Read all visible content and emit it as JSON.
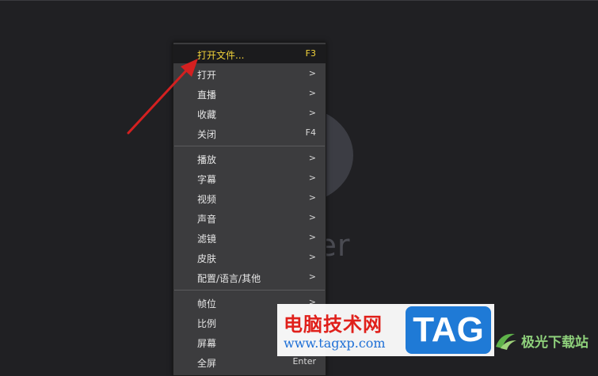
{
  "background": {
    "color": "#202023"
  },
  "player": {
    "brand_partial": "yer"
  },
  "context_menu": {
    "groups": [
      [
        {
          "label": "打开文件...",
          "shortcut": "F3",
          "highlighted": true
        },
        {
          "label": "打开",
          "shortcut": ">"
        },
        {
          "label": "直播",
          "shortcut": ">"
        },
        {
          "label": "收藏",
          "shortcut": ">"
        },
        {
          "label": "关闭",
          "shortcut": "F4"
        }
      ],
      [
        {
          "label": "播放",
          "shortcut": ">"
        },
        {
          "label": "字幕",
          "shortcut": ">"
        },
        {
          "label": "视频",
          "shortcut": ">"
        },
        {
          "label": "声音",
          "shortcut": ">"
        },
        {
          "label": "滤镜",
          "shortcut": ">"
        },
        {
          "label": "皮肤",
          "shortcut": ">"
        },
        {
          "label": "配置/语言/其他",
          "shortcut": ">"
        }
      ],
      [
        {
          "label": "帧位",
          "shortcut": ">"
        },
        {
          "label": "比例",
          "shortcut": ">"
        },
        {
          "label": "屏幕",
          "shortcut": ">"
        },
        {
          "label": "全屏",
          "shortcut": "Enter"
        }
      ]
    ],
    "highlight_color": "#f2d33a"
  },
  "annotation": {
    "arrow_color": "#d42020"
  },
  "watermark": {
    "title": "电脑技术网",
    "url": "www.tagxp.com",
    "tag": "TAG",
    "site": "极光下载站"
  }
}
